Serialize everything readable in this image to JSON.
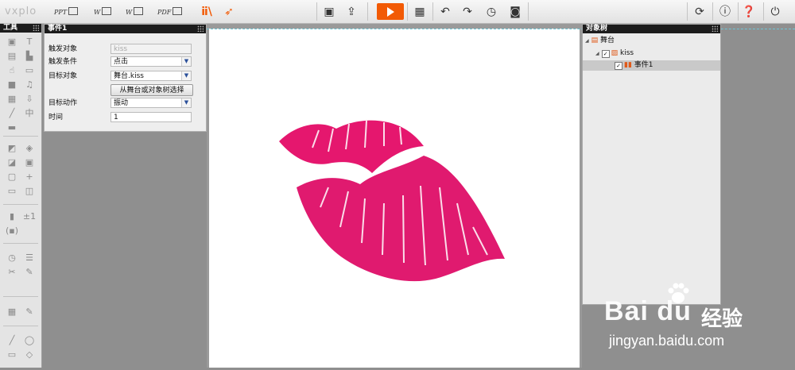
{
  "app": {
    "logo": "vxplo",
    "export_buttons": [
      "PPT",
      "W",
      "W",
      "PDF"
    ]
  },
  "toolbar_icons": [
    "save-icon",
    "import-icon",
    "play-icon",
    "qr-code-icon",
    "undo-icon",
    "redo-icon",
    "history-icon",
    "screenshot-icon",
    "refresh-icon",
    "info-icon",
    "help-icon",
    "power-icon"
  ],
  "tools_panel": {
    "title": "工具",
    "glyphs": [
      "▣",
      "T",
      "▤",
      "▙",
      "☝",
      "▭",
      "■",
      "♫",
      "▦",
      "⇩",
      "╱",
      "中",
      "▬",
      "",
      "◩",
      "◈",
      "◪",
      "▣",
      "▢",
      "+",
      "▭",
      "◫",
      "▮",
      "±1",
      "(▪)",
      "",
      "◷",
      "☰",
      "✂",
      "✎",
      "▦",
      "✎",
      "╱",
      "◯",
      "▭",
      "◇"
    ]
  },
  "event_panel": {
    "title": "事件1",
    "trigger_object": {
      "label": "触发对象",
      "value": "kiss"
    },
    "trigger_condition": {
      "label": "触发条件",
      "value": "点击"
    },
    "target_object": {
      "label": "目标对象",
      "value": "舞台.kiss"
    },
    "pick_button": "从舞台或对象树选择",
    "target_action": {
      "label": "目标动作",
      "value": "振动"
    },
    "time": {
      "label": "时间",
      "value": "1"
    }
  },
  "tree_panel": {
    "title": "对象树",
    "nodes": [
      {
        "label": "舞台",
        "level": 0
      },
      {
        "label": "kiss",
        "level": 1
      },
      {
        "label": "事件1",
        "level": 2
      }
    ]
  },
  "watermark": {
    "brand": "Bai du",
    "cn": "经验",
    "url": "jingyan.baidu.com"
  }
}
